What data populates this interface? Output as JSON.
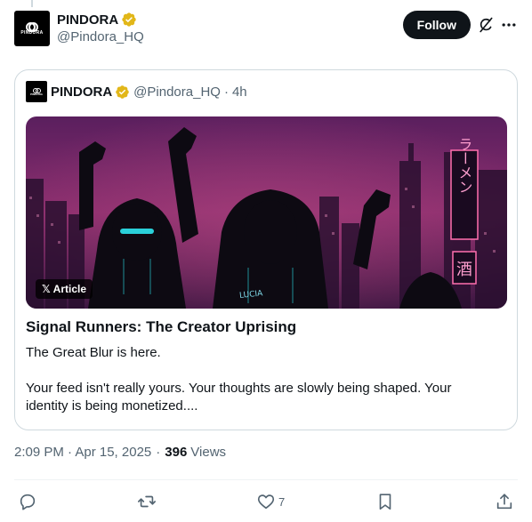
{
  "post": {
    "author_name": "PINDORA",
    "author_handle": "@Pindora_HQ",
    "avatar_text": "PINDORA",
    "follow_label": "Follow"
  },
  "quote": {
    "author_name": "PINDORA",
    "author_handle": "@Pindora_HQ",
    "separator": "·",
    "time": "4h",
    "badge_label": "Article",
    "article_title": "Signal Runners: The Creator Uprising",
    "article_paragraph_1": "The Great Blur is here.",
    "article_paragraph_2": "Your feed isn't really yours. Your thoughts are slowly being shaped. Your identity is being monetized....",
    "image_sign_text": "ラーメン",
    "image_sign_text_2": "酒",
    "image_jacket_text": "LUCIA"
  },
  "meta": {
    "timestamp": "2:09 PM · Apr 15, 2025",
    "separator": "·",
    "views_count": "396",
    "views_label": "Views"
  },
  "actions": {
    "like_count": "7"
  },
  "icons": {
    "verified": "verified-badge-icon",
    "grok": "grok-icon",
    "more": "more-icon",
    "reply": "reply-icon",
    "repost": "repost-icon",
    "like": "like-icon",
    "bookmark": "bookmark-icon",
    "share": "share-icon",
    "x_logo": "x-logo-icon"
  },
  "colors": {
    "text": "#0f1419",
    "secondary": "#536471",
    "border": "#cfd9de",
    "verified_gold": "#e2b719",
    "follow_bg": "#0f1419"
  }
}
